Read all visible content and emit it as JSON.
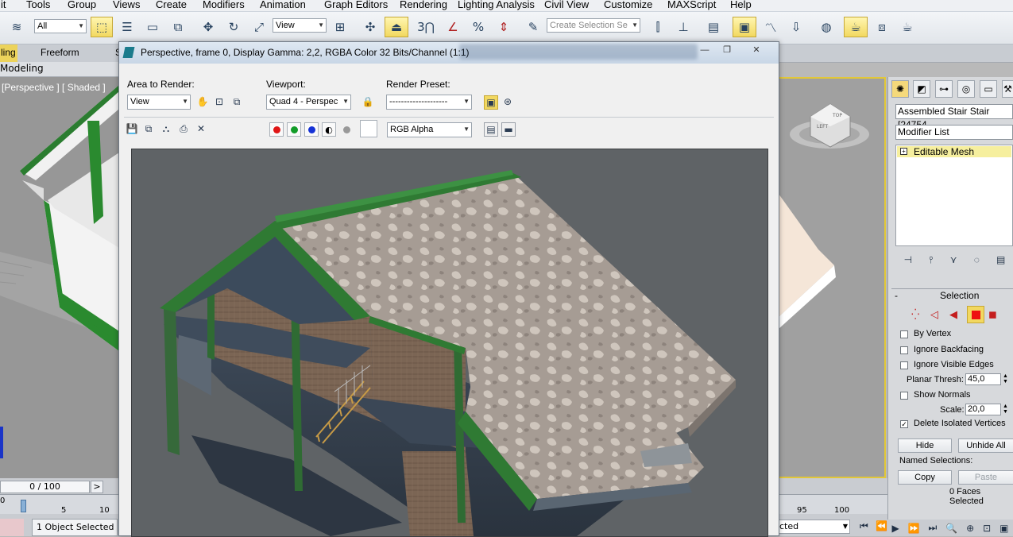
{
  "menu": [
    "it",
    "Tools",
    "Group",
    "Views",
    "Create",
    "Modifiers",
    "Animation",
    "Graph Editors",
    "Rendering",
    "Lighting Analysis",
    "Civil View",
    "Customize",
    "MAXScript",
    "Help"
  ],
  "toolbar": {
    "selection_filter": "All",
    "ref_coord": "View",
    "snap_number": "3",
    "angle_snap_label": "%",
    "named_selection_placeholder": "Create Selection Se"
  },
  "ribbon": {
    "tabs": [
      "ling",
      "Freeform",
      "S"
    ],
    "sub_tab": "Modeling"
  },
  "left_viewport": {
    "label": "[Perspective ] [ Shaded ]"
  },
  "render_window": {
    "title": "Perspective, frame 0, Display Gamma: 2,2, RGBA Color 32 Bits/Channel (1:1)",
    "area_label": "Area to Render:",
    "area_value": "View",
    "viewport_label": "Viewport:",
    "viewport_value": "Quad 4 - Perspec",
    "preset_label": "Render Preset:",
    "preset_value": "--------------------",
    "channel_value": "RGB Alpha"
  },
  "command_panel": {
    "object_name": "Assembled Stair Stair [24754",
    "modifier_list": "Modifier List",
    "stack_item": "Editable Mesh",
    "rollout_title": "Selection",
    "by_vertex": "By Vertex",
    "ignore_backfacing": "Ignore Backfacing",
    "ignore_visible_edges": "Ignore Visible Edges",
    "planar_thresh_label": "Planar Thresh:",
    "planar_thresh_value": "45,0",
    "show_normals": "Show Normals",
    "scale_label": "Scale:",
    "scale_value": "20,0",
    "delete_isolated": "Delete Isolated Vertices",
    "hide": "Hide",
    "unhide_all": "Unhide All",
    "named_selections": "Named Selections:",
    "copy": "Copy",
    "paste": "Paste",
    "faces_selected": "0 Faces Selected"
  },
  "timeline": {
    "frame_counter": "0 / 100",
    "next": ">",
    "ticks_left": [
      "0",
      "5",
      "10"
    ],
    "ticks_right": [
      "95",
      "100"
    ],
    "status": "1 Object Selected",
    "status_right": "cted"
  },
  "viewcube": {
    "face_left": "LEFT",
    "face_top": "TOP"
  },
  "colors": {
    "accent": "#ecd35b",
    "roof": "#a49b93",
    "trim": "#2f7a33"
  }
}
